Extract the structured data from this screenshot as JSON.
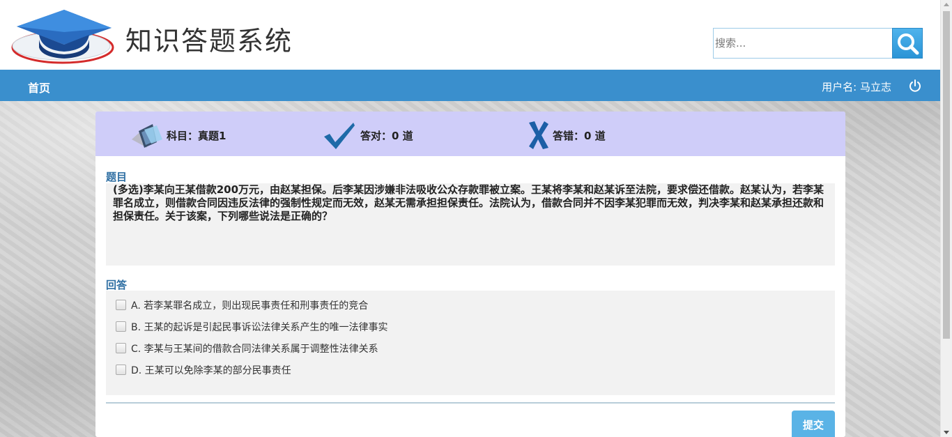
{
  "header": {
    "title": "知识答题系统",
    "search_placeholder": "搜索..."
  },
  "nav": {
    "home_label": "首页",
    "user_label": "用户名: 马立志"
  },
  "stats": {
    "subject": "科目：真题1",
    "correct": "答对：0 道",
    "wrong": "答错：0 道"
  },
  "question": {
    "section_label": "题目",
    "text": "(多选)李某向王某借款200万元，由赵某担保。后李某因涉嫌非法吸收公众存款罪被立案。王某将李某和赵某诉至法院，要求偿还借款。赵某认为，若李某罪名成立，则借款合同因违反法律的强制性规定而无效，赵某无需承担担保责任。法院认为，借款合同并不因李某犯罪而无效，判决李某和赵某承担还款和担保责任。关于该案，下列哪些说法是正确的？"
  },
  "answer": {
    "section_label": "回答",
    "options": [
      {
        "label": "A. 若李某罪名成立，则出现民事责任和刑事责任的竞合",
        "checked": false
      },
      {
        "label": "B. 王某的起诉是引起民事诉讼法律关系产生的唯一法律事实",
        "checked": false
      },
      {
        "label": "C. 李某与王某间的借款合同法律关系属于调整性法律关系",
        "checked": false
      },
      {
        "label": "D. 王某可以免除李某的部分民事责任",
        "checked": false
      }
    ]
  },
  "actions": {
    "submit_label": "提交"
  },
  "colors": {
    "navbar": "#3a8fcd",
    "stats_bar": "#cfcdf9",
    "accent_text": "#2f6fa3",
    "submit": "#5ab3e6",
    "check_icon": "#1e6aa8",
    "cross_icon": "#1c5fa6"
  }
}
